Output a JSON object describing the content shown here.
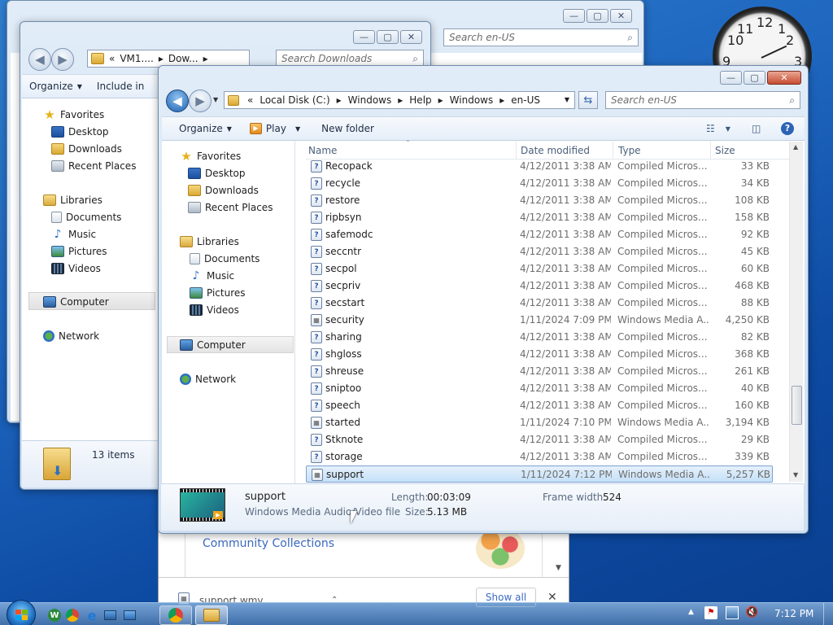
{
  "clock": {
    "numerals": [
      "12",
      "1",
      "2",
      "3",
      "9",
      "10",
      "11"
    ]
  },
  "bg_window": {
    "search_placeholder": "Search en-US"
  },
  "win2": {
    "address": {
      "prefix": "«",
      "crumbs": [
        "VM1....",
        "Dow..."
      ]
    },
    "search_placeholder": "Search Downloads",
    "toolbar": {
      "organize": "Organize",
      "include": "Include in"
    },
    "nav": {
      "favorites": "Favorites",
      "desktop": "Desktop",
      "downloads": "Downloads",
      "recent": "Recent Places",
      "libraries": "Libraries",
      "documents": "Documents",
      "music": "Music",
      "pictures": "Pictures",
      "videos": "Videos",
      "computer": "Computer",
      "network": "Network"
    },
    "status": "13 items"
  },
  "main": {
    "address": {
      "prefix": "«",
      "crumbs": [
        "Local Disk (C:)",
        "Windows",
        "Help",
        "Windows",
        "en-US"
      ]
    },
    "search_placeholder": "Search en-US",
    "toolbar": {
      "organize": "Organize",
      "play": "Play",
      "new_folder": "New folder"
    },
    "nav": {
      "favorites": "Favorites",
      "desktop": "Desktop",
      "downloads": "Downloads",
      "recent": "Recent Places",
      "libraries": "Libraries",
      "documents": "Documents",
      "music": "Music",
      "pictures": "Pictures",
      "videos": "Videos",
      "computer": "Computer",
      "network": "Network"
    },
    "columns": {
      "name": "Name",
      "date": "Date modified",
      "type": "Type",
      "size": "Size"
    },
    "files": [
      {
        "name": "Recopack",
        "date": "4/12/2011 3:38 AM",
        "type": "Compiled Micros...",
        "size": "33 KB",
        "kind": "chm"
      },
      {
        "name": "recycle",
        "date": "4/12/2011 3:38 AM",
        "type": "Compiled Micros...",
        "size": "34 KB",
        "kind": "chm"
      },
      {
        "name": "restore",
        "date": "4/12/2011 3:38 AM",
        "type": "Compiled Micros...",
        "size": "108 KB",
        "kind": "chm"
      },
      {
        "name": "ripbsyn",
        "date": "4/12/2011 3:38 AM",
        "type": "Compiled Micros...",
        "size": "158 KB",
        "kind": "chm"
      },
      {
        "name": "safemodc",
        "date": "4/12/2011 3:38 AM",
        "type": "Compiled Micros...",
        "size": "92 KB",
        "kind": "chm"
      },
      {
        "name": "seccntr",
        "date": "4/12/2011 3:38 AM",
        "type": "Compiled Micros...",
        "size": "45 KB",
        "kind": "chm"
      },
      {
        "name": "secpol",
        "date": "4/12/2011 3:38 AM",
        "type": "Compiled Micros...",
        "size": "60 KB",
        "kind": "chm"
      },
      {
        "name": "secpriv",
        "date": "4/12/2011 3:38 AM",
        "type": "Compiled Micros...",
        "size": "468 KB",
        "kind": "chm"
      },
      {
        "name": "secstart",
        "date": "4/12/2011 3:38 AM",
        "type": "Compiled Micros...",
        "size": "88 KB",
        "kind": "chm"
      },
      {
        "name": "security",
        "date": "1/11/2024 7:09 PM",
        "type": "Windows Media A...",
        "size": "4,250 KB",
        "kind": "media"
      },
      {
        "name": "sharing",
        "date": "4/12/2011 3:38 AM",
        "type": "Compiled Micros...",
        "size": "82 KB",
        "kind": "chm"
      },
      {
        "name": "shgloss",
        "date": "4/12/2011 3:38 AM",
        "type": "Compiled Micros...",
        "size": "368 KB",
        "kind": "chm"
      },
      {
        "name": "shreuse",
        "date": "4/12/2011 3:38 AM",
        "type": "Compiled Micros...",
        "size": "261 KB",
        "kind": "chm"
      },
      {
        "name": "sniptoo",
        "date": "4/12/2011 3:38 AM",
        "type": "Compiled Micros...",
        "size": "40 KB",
        "kind": "chm"
      },
      {
        "name": "speech",
        "date": "4/12/2011 3:38 AM",
        "type": "Compiled Micros...",
        "size": "160 KB",
        "kind": "chm"
      },
      {
        "name": "started",
        "date": "1/11/2024 7:10 PM",
        "type": "Windows Media A...",
        "size": "3,194 KB",
        "kind": "media"
      },
      {
        "name": "Stknote",
        "date": "4/12/2011 3:38 AM",
        "type": "Compiled Micros...",
        "size": "29 KB",
        "kind": "chm"
      },
      {
        "name": "storage",
        "date": "4/12/2011 3:38 AM",
        "type": "Compiled Micros...",
        "size": "339 KB",
        "kind": "chm"
      },
      {
        "name": "support",
        "date": "1/11/2024 7:12 PM",
        "type": "Windows Media A...",
        "size": "5,257 KB",
        "kind": "media",
        "selected": true
      }
    ],
    "details": {
      "name": "support",
      "type": "Windows Media Audio/Video file",
      "length_label": "Length:",
      "length": "00:03:09",
      "size_label": "Size:",
      "size": "5.13 MB",
      "frame_label": "Frame width:",
      "frame": "524"
    }
  },
  "browser": {
    "community": "Community Collections",
    "download_name": "support.wmv",
    "show_all": "Show all"
  },
  "tray": {
    "time": "7:12 PM"
  }
}
